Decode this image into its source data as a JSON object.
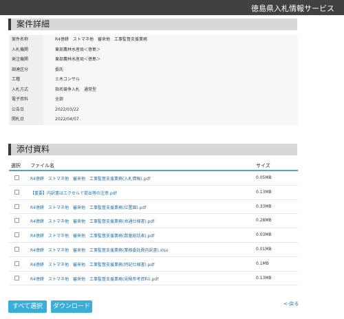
{
  "header": {
    "site_name": "徳島県入札情報サービス"
  },
  "details": {
    "title": "案件詳細",
    "rows": [
      {
        "label": "案件名称",
        "value": "R4徳耕　ストマネ他　審来他　工事監督支援業務"
      },
      {
        "label": "入札機関",
        "value": "東部農林水産局＜徳島＞"
      },
      {
        "label": "発注機関",
        "value": "東部農林水産局＜徳島＞"
      },
      {
        "label": "調達区分",
        "value": "委託"
      },
      {
        "label": "工種",
        "value": "土木コンサル"
      },
      {
        "label": "入札方式",
        "value": "指名競争入札　通常型"
      },
      {
        "label": "電子資料",
        "value": "全部"
      },
      {
        "label": "公告日",
        "value": "2022/03/22"
      },
      {
        "label": "開札日",
        "value": "2022/04/07"
      }
    ]
  },
  "attachments": {
    "title": "添付資料",
    "columns": {
      "select": "選択",
      "file_name": "ファイル名",
      "size": "サイズ"
    },
    "files": [
      {
        "name": "R4徳耕　ストマネ他　審来他　工事監督支援業務(入札情報).pdf",
        "size": "0.05MB"
      },
      {
        "name": "【重要】内訳書はエクセルで提出等の注意.pdf",
        "size": "0.13MB"
      },
      {
        "name": "R4徳耕　ストマネ他　審来他　工事監督支援業務(位置図).pdf",
        "size": "0.33MB"
      },
      {
        "name": "R4徳耕　ストマネ他　審来他　工事監督支援業務(共通仕様書).pdf",
        "size": "0.28MB"
      },
      {
        "name": "R4徳耕　ストマネ他　審来他　工事監督支援業務(数量総括表).pdf",
        "size": "0.03MB"
      },
      {
        "name": "R4徳耕　ストマネ他　審来他　工事監督支援業務(業務委託費内訳書).xlsx",
        "size": "0.01MB"
      },
      {
        "name": "R4徳耕　ストマネ他　審来他　工事監督支援業務(特記仕様書).pdf",
        "size": "0.1MB"
      },
      {
        "name": "R4徳耕　ストマネ他　審来他　工事監督支援業務(見積参考資料).pdf",
        "size": "0.13MB"
      }
    ]
  },
  "actions": {
    "select_all": "すべて選択",
    "download": "ダウンロード",
    "back": "<-戻る"
  }
}
